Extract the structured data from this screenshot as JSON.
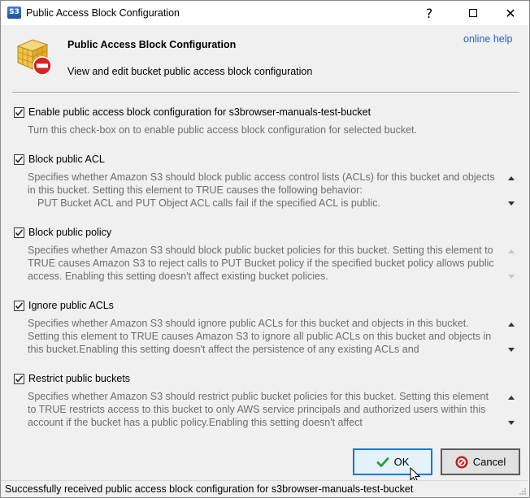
{
  "window": {
    "title": "Public Access Block Configuration",
    "app_icon_text": "S3",
    "controls": {
      "help": "?",
      "close": "✕"
    }
  },
  "header": {
    "title": "Public Access Block Configuration",
    "subtitle": "View and edit bucket public access block configuration",
    "online_help": "online help"
  },
  "main_option": {
    "label": "Enable public access block configuration for s3browser-manuals-test-bucket",
    "checked": true,
    "description": "Turn this check-box on to enable public access block configuration for selected bucket."
  },
  "options": [
    {
      "label": "Block public ACL",
      "checked": true,
      "description": "Specifies whether Amazon S3 should block public access control lists (ACLs) for this bucket and objects in this bucket. Setting this element to TRUE causes the following behavior:",
      "description_extra": "PUT Bucket ACL and PUT Object ACL calls fail if the specified ACL is public.",
      "scroll_enabled": true
    },
    {
      "label": "Block public policy",
      "checked": true,
      "description": "Specifies whether Amazon S3 should block public bucket policies for this bucket. Setting this element to TRUE causes Amazon S3 to reject calls to PUT Bucket policy if the specified bucket policy allows public access. Enabling this setting doesn't affect existing bucket policies.",
      "scroll_enabled": false
    },
    {
      "label": "Ignore public ACLs",
      "checked": true,
      "description": "Specifies whether Amazon S3 should ignore public ACLs for this bucket and objects in this bucket. Setting this element to TRUE causes Amazon S3 to ignore all public ACLs on this bucket and objects in this bucket.Enabling this setting doesn't affect the persistence of any existing ACLs and",
      "scroll_enabled": true
    },
    {
      "label": "Restrict public buckets",
      "checked": true,
      "description": "Specifies whether Amazon S3 should restrict public bucket policies for this bucket. Setting this element to TRUE restricts access to this bucket to only AWS service principals and authorized users within this account if the bucket has a public policy.Enabling this setting doesn't affect",
      "scroll_enabled": true
    }
  ],
  "buttons": {
    "ok": "OK",
    "cancel": "Cancel"
  },
  "status": "Successfully received public access block configuration for s3browser-manuals-test-bucket",
  "colors": {
    "link": "#2463c4",
    "ok_border": "#0078d7",
    "desc_text": "#6d6d6d"
  }
}
